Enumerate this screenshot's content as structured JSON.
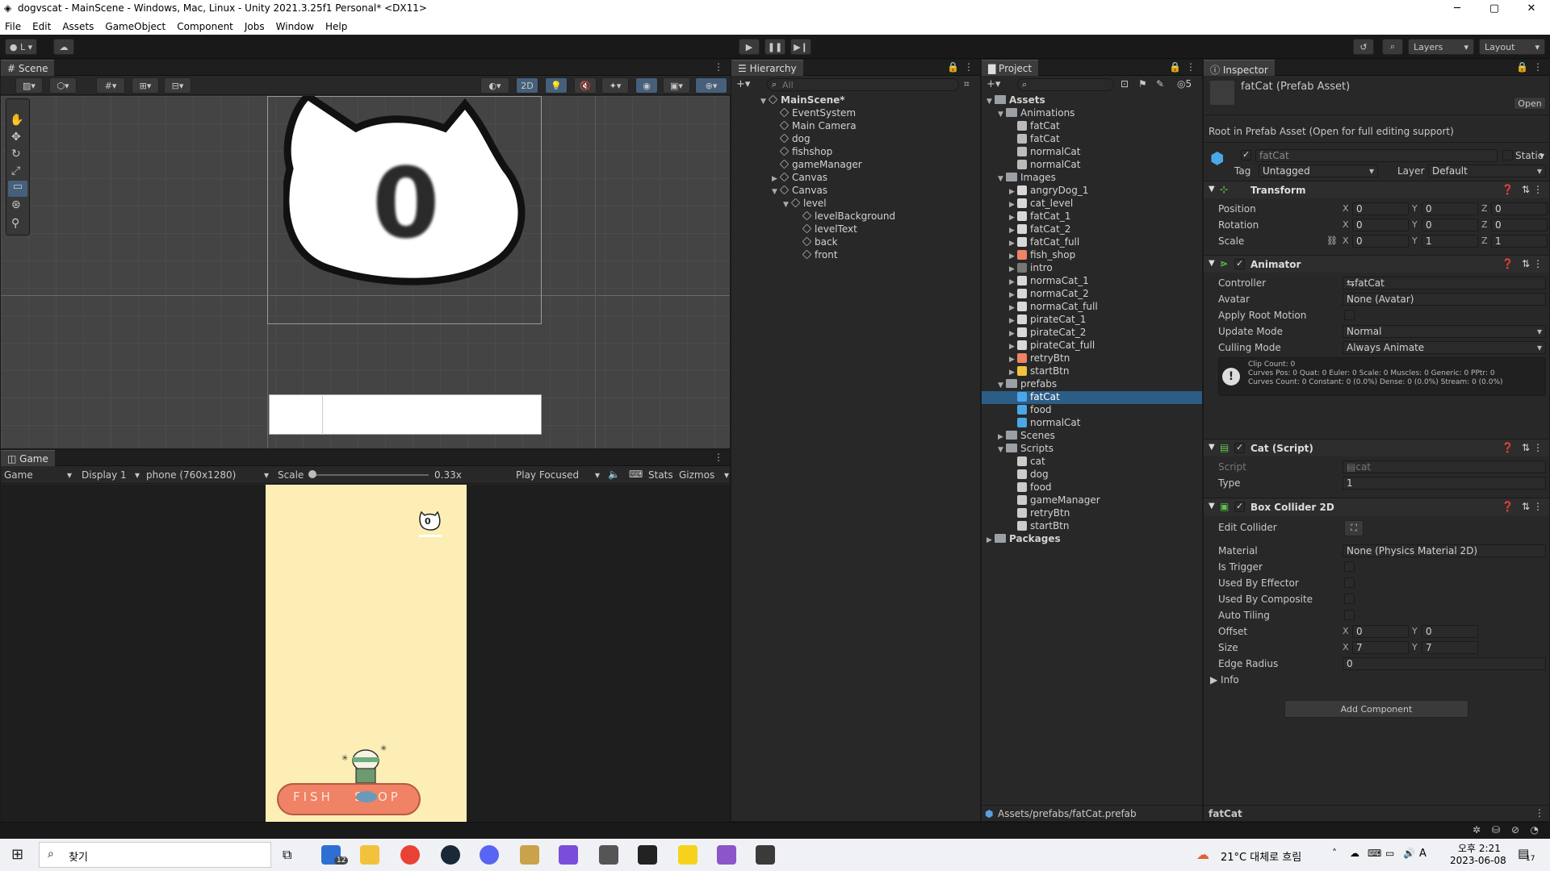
{
  "window": {
    "title": "dogvscat - MainScene - Windows, Mac, Linux - Unity 2021.3.25f1 Personal* <DX11>",
    "min": "─",
    "max": "▢",
    "close": "✕"
  },
  "menu": [
    "File",
    "Edit",
    "Assets",
    "GameObject",
    "Component",
    "Jobs",
    "Window",
    "Help"
  ],
  "toolbar": {
    "account": "L",
    "layers": "Layers",
    "layout": "Layout"
  },
  "scene": {
    "tab": "Scene",
    "mode_2d": "2D",
    "level_number": "0"
  },
  "game": {
    "tab": "Game",
    "game_dropdown": "Game",
    "display": "Display 1",
    "resolution": "phone (760x1280)",
    "scale_label": "Scale",
    "scale_value": "0.33x",
    "play_focused": "Play Focused",
    "stats": "Stats",
    "gizmos": "Gizmos",
    "level_number": "0",
    "shop_text": "FISH   SHOP"
  },
  "hierarchy": {
    "tab": "Hierarchy",
    "search_placeholder": "All",
    "items": [
      {
        "label": "MainScene*",
        "depth": 0,
        "arrow": "▼",
        "bold": true
      },
      {
        "label": "EventSystem",
        "depth": 1,
        "arrow": ""
      },
      {
        "label": "Main Camera",
        "depth": 1,
        "arrow": ""
      },
      {
        "label": "dog",
        "depth": 1,
        "arrow": ""
      },
      {
        "label": "fishshop",
        "depth": 1,
        "arrow": ""
      },
      {
        "label": "gameManager",
        "depth": 1,
        "arrow": ""
      },
      {
        "label": "Canvas",
        "depth": 1,
        "arrow": "▶"
      },
      {
        "label": "Canvas",
        "depth": 1,
        "arrow": "▼"
      },
      {
        "label": "level",
        "depth": 2,
        "arrow": "▼"
      },
      {
        "label": "levelBackground",
        "depth": 3,
        "arrow": ""
      },
      {
        "label": "levelText",
        "depth": 3,
        "arrow": ""
      },
      {
        "label": "back",
        "depth": 3,
        "arrow": ""
      },
      {
        "label": "front",
        "depth": 3,
        "arrow": ""
      }
    ]
  },
  "project": {
    "tab": "Project",
    "hidden_count": "5",
    "path": "Assets/prefabs/fatCat.prefab",
    "items": [
      {
        "label": "Assets",
        "depth": 0,
        "type": "folder",
        "arrow": "▼",
        "bold": true
      },
      {
        "label": "Animations",
        "depth": 1,
        "type": "folder",
        "arrow": "▼"
      },
      {
        "label": "fatCat",
        "depth": 2,
        "type": "anim",
        "arrow": ""
      },
      {
        "label": "fatCat",
        "depth": 2,
        "type": "animctrl",
        "arrow": ""
      },
      {
        "label": "normalCat",
        "depth": 2,
        "type": "anim",
        "arrow": ""
      },
      {
        "label": "normalCat",
        "depth": 2,
        "type": "animctrl",
        "arrow": ""
      },
      {
        "label": "Images",
        "depth": 1,
        "type": "folder",
        "arrow": "▼"
      },
      {
        "label": "angryDog_1",
        "depth": 2,
        "type": "image",
        "arrow": "▶"
      },
      {
        "label": "cat_level",
        "depth": 2,
        "type": "image",
        "arrow": "▶"
      },
      {
        "label": "fatCat_1",
        "depth": 2,
        "type": "image",
        "arrow": "▶"
      },
      {
        "label": "fatCat_2",
        "depth": 2,
        "type": "image",
        "arrow": "▶"
      },
      {
        "label": "fatCat_full",
        "depth": 2,
        "type": "image",
        "arrow": "▶"
      },
      {
        "label": "fish_shop",
        "depth": 2,
        "type": "image-shop",
        "arrow": "▶"
      },
      {
        "label": "intro",
        "depth": 2,
        "type": "image-intro",
        "arrow": "▶"
      },
      {
        "label": "normaCat_1",
        "depth": 2,
        "type": "image",
        "arrow": "▶"
      },
      {
        "label": "normaCat_2",
        "depth": 2,
        "type": "image",
        "arrow": "▶"
      },
      {
        "label": "normaCat_full",
        "depth": 2,
        "type": "image",
        "arrow": "▶"
      },
      {
        "label": "pirateCat_1",
        "depth": 2,
        "type": "image",
        "arrow": "▶"
      },
      {
        "label": "pirateCat_2",
        "depth": 2,
        "type": "image",
        "arrow": "▶"
      },
      {
        "label": "pirateCat_full",
        "depth": 2,
        "type": "image",
        "arrow": "▶"
      },
      {
        "label": "retryBtn",
        "depth": 2,
        "type": "image-btn",
        "arrow": "▶"
      },
      {
        "label": "startBtn",
        "depth": 2,
        "type": "image-btn2",
        "arrow": "▶"
      },
      {
        "label": "prefabs",
        "depth": 1,
        "type": "folder",
        "arrow": "▼"
      },
      {
        "label": "fatCat",
        "depth": 2,
        "type": "prefab",
        "arrow": "",
        "selected": true
      },
      {
        "label": "food",
        "depth": 2,
        "type": "prefab",
        "arrow": ""
      },
      {
        "label": "normalCat",
        "depth": 2,
        "type": "prefab",
        "arrow": ""
      },
      {
        "label": "Scenes",
        "depth": 1,
        "type": "folder",
        "arrow": "▶"
      },
      {
        "label": "Scripts",
        "depth": 1,
        "type": "folder",
        "arrow": "▼"
      },
      {
        "label": "cat",
        "depth": 2,
        "type": "script",
        "arrow": ""
      },
      {
        "label": "dog",
        "depth": 2,
        "type": "script",
        "arrow": ""
      },
      {
        "label": "food",
        "depth": 2,
        "type": "script",
        "arrow": ""
      },
      {
        "label": "gameManager",
        "depth": 2,
        "type": "gear",
        "arrow": ""
      },
      {
        "label": "retryBtn",
        "depth": 2,
        "type": "script",
        "arrow": ""
      },
      {
        "label": "startBtn",
        "depth": 2,
        "type": "script",
        "arrow": ""
      },
      {
        "label": "Packages",
        "depth": 0,
        "type": "folder",
        "arrow": "▶",
        "bold": true
      }
    ]
  },
  "inspector": {
    "tab": "Inspector",
    "asset_title": "fatCat (Prefab Asset)",
    "open_button": "Open",
    "root_note": "Root in Prefab Asset (Open for full editing support)",
    "name": "fatCat",
    "static_label": "Static",
    "tag_label": "Tag",
    "tag_value": "Untagged",
    "layer_label": "Layer",
    "layer_value": "Default",
    "transform": {
      "title": "Transform",
      "position_label": "Position",
      "rotation_label": "Rotation",
      "scale_label": "Scale",
      "position": [
        "0",
        "0",
        "0"
      ],
      "rotation": [
        "0",
        "0",
        "0"
      ],
      "scale": [
        "0",
        "1",
        "1"
      ]
    },
    "animator": {
      "title": "Animator",
      "controller_label": "Controller",
      "controller_value": "fatCat",
      "avatar_label": "Avatar",
      "avatar_value": "None (Avatar)",
      "apply_root_motion_label": "Apply Root Motion",
      "update_mode_label": "Update Mode",
      "update_mode_value": "Normal",
      "culling_mode_label": "Culling Mode",
      "culling_mode_value": "Always Animate",
      "info_line1": "Clip Count: 0",
      "info_line2": "Curves Pos: 0 Quat: 0 Euler: 0 Scale: 0 Muscles: 0 Generic: 0 PPtr: 0",
      "info_line3": "Curves Count: 0 Constant: 0 (0.0%) Dense: 0 (0.0%) Stream: 0 (0.0%)"
    },
    "cat_script": {
      "title": "Cat (Script)",
      "script_label": "Script",
      "script_value": "cat",
      "type_label": "Type",
      "type_value": "1"
    },
    "box_collider": {
      "title": "Box Collider 2D",
      "edit_collider_label": "Edit Collider",
      "material_label": "Material",
      "material_value": "None (Physics Material 2D)",
      "is_trigger_label": "Is Trigger",
      "used_by_effector_label": "Used By Effector",
      "used_by_composite_label": "Used By Composite",
      "auto_tiling_label": "Auto Tiling",
      "offset_label": "Offset",
      "offset": [
        "0",
        "0"
      ],
      "size_label": "Size",
      "size": [
        "7",
        "7"
      ],
      "edge_radius_label": "Edge Radius",
      "edge_radius_value": "0",
      "info_label": "Info"
    },
    "add_component": "Add Component",
    "footer_name": "fatCat"
  },
  "taskbar": {
    "search_label": "찾기",
    "mail_badge": "12",
    "weather": "21°C 대체로 흐림",
    "ampm_time": "오후 2:21",
    "date": "2023-06-08",
    "ime": "A",
    "notif_count": "17"
  },
  "colors": {
    "selection": "#2c5d87",
    "game_bg": "#fdeeb5",
    "shop_red": "#f08266",
    "editor_dark": "#191919"
  }
}
